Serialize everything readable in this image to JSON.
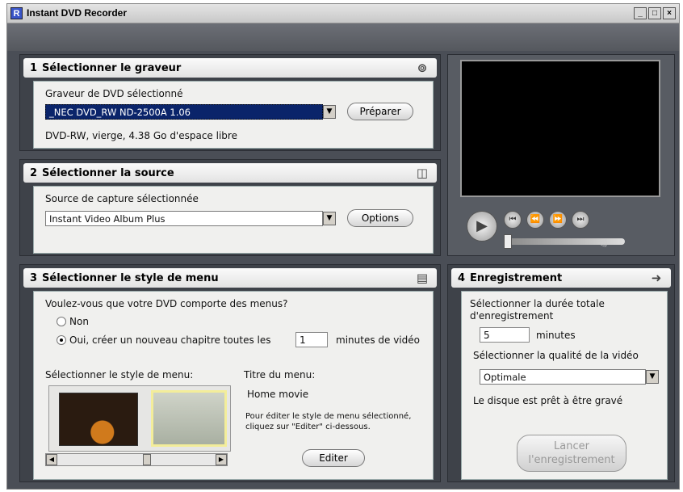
{
  "window": {
    "title": "Instant DVD Recorder",
    "app_icon": "R"
  },
  "step1": {
    "number": "1",
    "title": "Sélectionner le graveur",
    "drive_label": "Graveur de DVD sélectionné",
    "drive_value": "_NEC    DVD_RW ND-2500A 1.06",
    "prepare_label": "Préparer",
    "status": "DVD-RW, vierge, 4.38 Go d'espace libre"
  },
  "step2": {
    "number": "2",
    "title": "Sélectionner la source",
    "source_label": "Source de capture sélectionnée",
    "source_value": "Instant Video Album Plus",
    "options_label": "Options"
  },
  "step3": {
    "number": "3",
    "title": "Sélectionner le style de menu",
    "question": "Voulez-vous que votre DVD comporte des menus?",
    "option_no": "Non",
    "option_yes": "Oui, créer un nouveau chapitre toutes les",
    "chapter_minutes": "1",
    "minutes_suffix": "minutes de vidéo",
    "style_label": "Sélectionner le style de menu:",
    "menu_title_label": "Titre du menu:",
    "menu_title_value": "Home movie",
    "edit_hint": "Pour éditer le style de menu sélectionné, cliquez sur \"Editer\" ci-dessous.",
    "edit_label": "Editer"
  },
  "step4": {
    "number": "4",
    "title": "Enregistrement",
    "duration_label": "Sélectionner la durée totale d'enregistrement",
    "duration_value": "5",
    "duration_unit": "minutes",
    "quality_label": "Sélectionner la qualité de la vidéo",
    "quality_value": "Optimale",
    "ready_text": "Le disque est prêt à être gravé",
    "record_label_1": "Lancer",
    "record_label_2": "l'enregistrement"
  },
  "colors": {
    "app_bg": "#4a4e56",
    "panel_bg": "#3e4249",
    "content_bg": "#f0f0ee",
    "selection": "#0a246a"
  }
}
